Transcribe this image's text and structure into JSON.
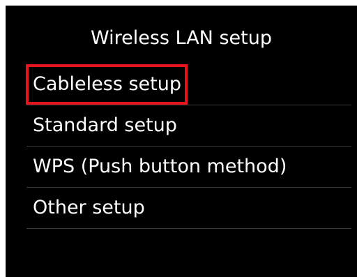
{
  "screen": {
    "title": "Wireless LAN setup"
  },
  "menu": {
    "items": [
      {
        "label": "Cableless setup",
        "selected": true
      },
      {
        "label": "Standard setup",
        "selected": false
      },
      {
        "label": "WPS (Push button method)",
        "selected": false
      },
      {
        "label": "Other setup",
        "selected": false
      }
    ]
  },
  "colors": {
    "background": "#000000",
    "text": "#ffffff",
    "selection_border": "#e3141c",
    "divider": "#3a3a3a"
  }
}
